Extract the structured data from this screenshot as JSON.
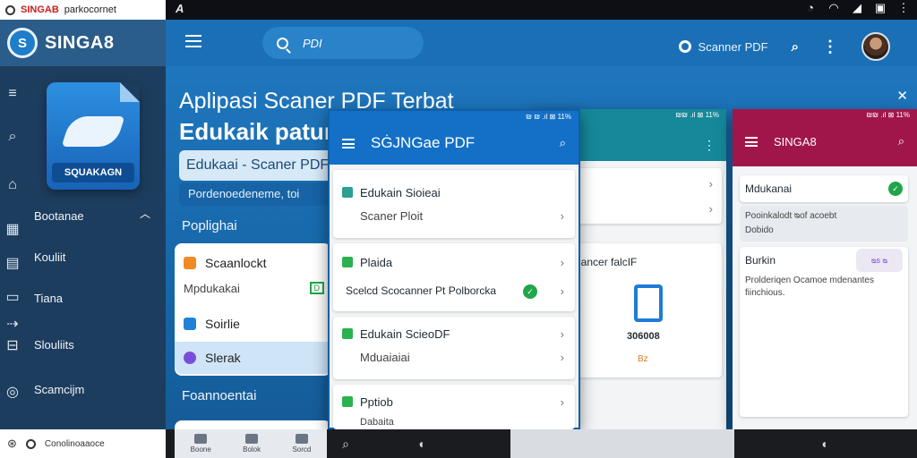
{
  "system_bar": {
    "tab_title": "SINGAB",
    "tab_subtitle": "parkocornet",
    "left_icon_text": "A"
  },
  "sidebar": {
    "brand": "SINGA8",
    "tile_label": "SQUAKAGN",
    "items": [
      {
        "label": "Bootanae"
      },
      {
        "label": "Kouliit"
      },
      {
        "label": "Tiana"
      },
      {
        "label": "Slouliits"
      },
      {
        "label": "Scamcijm"
      }
    ]
  },
  "header": {
    "search_text": "PDI",
    "scanner_label": "Scanner PDF"
  },
  "main": {
    "headline_1": "Aplipasi Scaner PDF Terbat",
    "headline_2": "Edukaik patun",
    "pill_text": "Edukaai - Scaner PDF",
    "pill2_text": "Pordenoedeneme, toi",
    "section_1": "Poplighai",
    "section_2": "Foannoentai",
    "card_rows": [
      {
        "label": "Scaanlockt",
        "color": "#f08a24"
      },
      {
        "label": "Mpdukakai",
        "color": "#ffffff"
      },
      {
        "label": "Soirlie",
        "color": "#1f82d6"
      },
      {
        "label": "Slerak",
        "color": "#7a4fd8"
      }
    ],
    "card_badge": "D"
  },
  "phone_center": {
    "status": "₪ ₪ .ıl ⊠ 11%",
    "title": "SĠJNGae PDF",
    "cards": [
      {
        "title": "Edukain Sioieai",
        "sub": "Scaner Ploit"
      },
      {
        "title": "Plaida",
        "sub": "Scelcd Scocanner Pt Polborcka"
      },
      {
        "title": "Edukain ScieoDF",
        "sub": "Mduaiaiai"
      },
      {
        "title": "Pptiob",
        "sub": "Dabaita"
      }
    ]
  },
  "phone_mid": {
    "status": "₪₪ .ıl ⊠ 11%",
    "row_label": "lancer falcIF",
    "doc_label": "306008",
    "doc_sub": "Bz"
  },
  "phone_right": {
    "status": "₪₪ .ıl ⊠ 11%",
    "title": "SINGA8",
    "row1": "Mdukanai",
    "row2_line1": "Pooinkalodt ᴓof acoebt",
    "row2_line2": "Dobido",
    "row3": "Burkin",
    "row3_badge": "ᴓs ᴓ",
    "row4_line1": "Prolderiqen Ocamoe mdenantes",
    "row4_line2": "fiinchious."
  },
  "bottom_bar": {
    "left_text": "Conolinoaaoce",
    "tabs": [
      "Boone",
      "Bolok",
      "Sorcd"
    ]
  },
  "colors": {
    "accent_blue": "#1a6fb5",
    "phone_center_bar": "#1470c6",
    "phone_mid_bar": "#15889a",
    "phone_right_bar": "#a0164a",
    "sidebar": "#1d3d5e"
  }
}
